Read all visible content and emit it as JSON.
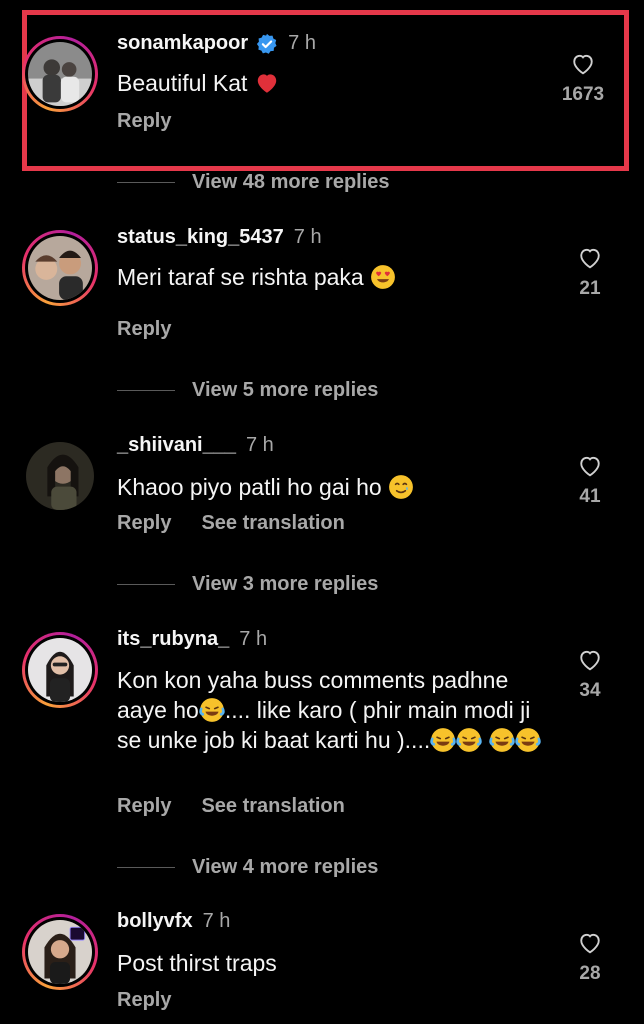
{
  "colors": {
    "background": "#000000",
    "highlight": "#e5384a",
    "verified": "#3897f0",
    "muted": "#a8a8a8"
  },
  "comments": [
    {
      "username": "sonamkapoor",
      "verified": true,
      "time": "7 h",
      "text": "Beautiful Kat",
      "emoji": "red-heart",
      "actions": [
        "Reply"
      ],
      "likes": "1673"
    },
    {
      "username": "status_king_5437",
      "verified": false,
      "time": "7 h",
      "text": "Meri taraf se rishta paka",
      "emoji": "heart-eyes",
      "actions": [
        "Reply"
      ],
      "likes": "21",
      "view_more_before": "View 48 more replies"
    },
    {
      "username": "_shiivani___",
      "verified": false,
      "time": "7 h",
      "text": "Khaoo piyo patli ho gai ho",
      "emoji": "smiling-tear",
      "actions": [
        "Reply",
        "See translation"
      ],
      "likes": "41",
      "view_more_before": "View 5 more replies"
    },
    {
      "username": "its_rubyna_",
      "verified": false,
      "time": "7 h",
      "text_parts": [
        "Kon kon yaha buss comments padhne aaye ho",
        ".... like karo ( phir main modi ji se unke job ki baat karti hu )...."
      ],
      "emoji": "tears-of-joy",
      "actions": [
        "Reply",
        "See translation"
      ],
      "likes": "34",
      "view_more_before": "View 3 more replies"
    },
    {
      "username": "bollyvfx",
      "verified": false,
      "time": "7 h",
      "text": "Post thirst traps",
      "actions": [
        "Reply"
      ],
      "likes": "28",
      "view_more_before": "View 4 more replies"
    }
  ]
}
